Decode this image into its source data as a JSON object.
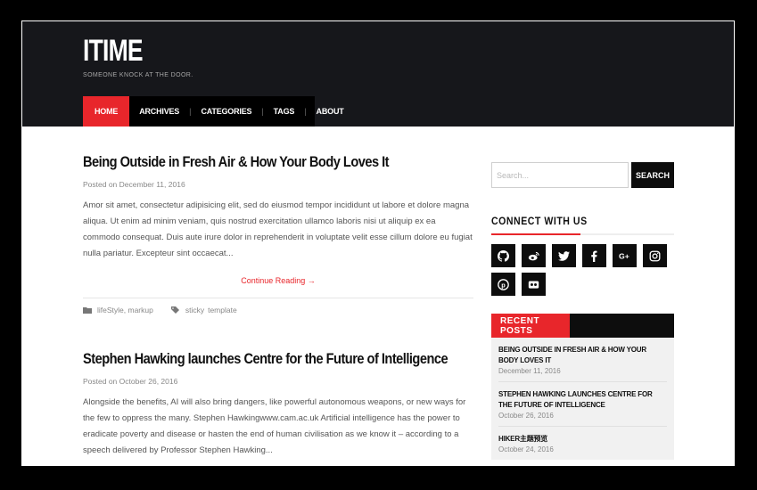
{
  "header": {
    "site_title": "ITIME",
    "site_description": "SOMEONE KNOCK AT THE DOOR.",
    "nav": [
      {
        "label": "HOME",
        "active": true
      },
      {
        "label": "ARCHIVES",
        "active": false
      },
      {
        "label": "CATEGORIES",
        "active": false
      },
      {
        "label": "TAGS",
        "active": false
      },
      {
        "label": "ABOUT",
        "active": false
      }
    ]
  },
  "posts": [
    {
      "title": "Being Outside in Fresh Air & How Your Body Loves It",
      "meta": "Posted on December 11, 2016",
      "excerpt": "Amor sit amet, consectetur adipisicing elit, sed do eiusmod tempor incididunt ut labore et dolore magna aliqua. Ut enim ad minim veniam, quis nostrud exercitation ullamco laboris nisi ut aliquip ex ea commodo consequat. Duis aute irure dolor in reprehenderit in voluptate velit esse cillum dolore eu fugiat nulla pariatur. Excepteur sint occaecat...",
      "continue_label": "Continue Reading →",
      "categories": "lifeStyle, markup",
      "tags": [
        "sticky",
        "template"
      ]
    },
    {
      "title": "Stephen Hawking launches Centre for the Future of Intelligence",
      "meta": "Posted on October 26, 2016",
      "excerpt": "Alongside the benefits, AI will also bring dangers, like powerful autonomous weapons, or new ways for the few to oppress the many. Stephen Hawkingwww.cam.ac.uk Artificial intelligence has the power to eradicate poverty and disease or hasten the end of human civilisation as we know it – according to a speech delivered by Professor Stephen Hawking..."
    }
  ],
  "sidebar": {
    "search_placeholder": "Search...",
    "search_button": "SEARCH",
    "connect_title": "CONNECT WITH US",
    "social_icons": [
      "github-icon",
      "weibo-icon",
      "twitter-icon",
      "facebook-icon",
      "google-plus-icon",
      "instagram-icon",
      "pinterest-icon",
      "flickr-icon"
    ],
    "recent_title": "RECENT POSTS",
    "recent_posts": [
      {
        "title": "BEING OUTSIDE IN FRESH AIR & HOW YOUR BODY LOVES IT",
        "date": "December 11, 2016"
      },
      {
        "title": "STEPHEN HAWKING LAUNCHES CENTRE FOR THE FUTURE OF INTELLIGENCE",
        "date": "October 26, 2016"
      },
      {
        "title": "HIKER主题预览",
        "date": "October 24, 2016"
      }
    ]
  },
  "colors": {
    "accent": "#e8262b",
    "header_bg": "#16171b",
    "dark": "#0d0d0d"
  }
}
